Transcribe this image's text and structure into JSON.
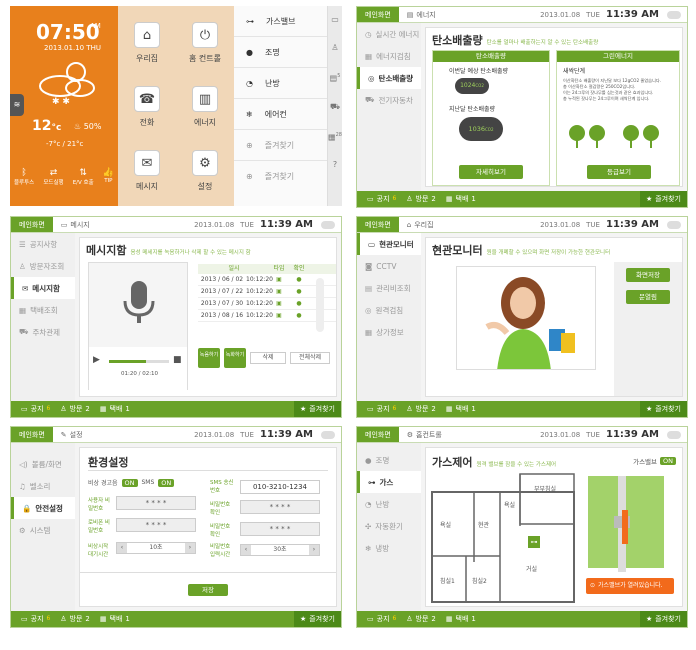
{
  "common": {
    "home": "메인화면",
    "date": "2013.01.08",
    "day": "TUE",
    "time": "11:39 AM",
    "bottom": {
      "notice": "공지",
      "notice_count": "6",
      "visit": "방문",
      "visit_count": "2",
      "delivery": "택배",
      "delivery_count": "1",
      "favorite": "즐겨찾기"
    }
  },
  "p1": {
    "time": "07:50",
    "ampm": "AM",
    "date": "2013.01.10 THU",
    "temp": "12",
    "temp_unit": "°c",
    "humidity": "50%",
    "range": "-7°c / 21°c",
    "status": [
      "블루투스",
      "모드실행",
      "E/V 호출",
      "TIP"
    ],
    "tiles": [
      "우리집",
      "홈 컨트롤",
      "전화",
      "에너지",
      "메시지",
      "설정"
    ],
    "list": [
      "가스밸브",
      "조명",
      "난방",
      "에어컨",
      "즐겨찾기",
      "즐겨찾기"
    ],
    "strip_badges": [
      "5",
      "28"
    ]
  },
  "p2": {
    "title": "에너지",
    "sidebar": [
      "실시간 에너지",
      "에너지검침",
      "탄소배출량",
      "전기자동차"
    ],
    "heading": "탄소배출량",
    "sub": "탄소를 얼마나 배출하는지 알 수 있는 탄소배출량",
    "box1": {
      "title": "탄소배출량",
      "line1": "이번달 예상 탄소배출량",
      "v1": "1024",
      "line2": "지난달 탄소배출량",
      "v2": "1036",
      "unit": "CO2",
      "btn": "자세히보기"
    },
    "box2": {
      "title": "그린에너지",
      "h": "새싹단계",
      "t1": "이산화탄소 배출량이 지난달 보다 12gCO2 줄었습니다.",
      "t2": "총 이산화탄소 절감량은 250CO2입니다.",
      "t3": "이는 24그루의 잣나무를 심는것과 같은 효과입니다.",
      "t4": "총 누적된 잣나무는 24그루이며 새싹단계 입니다.",
      "btn": "등급보기"
    }
  },
  "p3": {
    "title": "메시지",
    "sidebar": [
      "공지사항",
      "방문자조회",
      "메시지함",
      "택배조회",
      "주차관제"
    ],
    "heading": "메시지함",
    "sub": "음성 메세지를 녹음하거나 삭제 할 수 있는 메시지 함",
    "cols": [
      "일시",
      "타입",
      "확인"
    ],
    "rows": [
      {
        "d": "2013 / 06 / 02",
        "t": "10:12:20"
      },
      {
        "d": "2013 / 07 / 22",
        "t": "10:12:20"
      },
      {
        "d": "2013 / 07 / 30",
        "t": "10:12:20"
      },
      {
        "d": "2013 / 08 / 16",
        "t": "10:12:20"
      }
    ],
    "progress": "01:20 / 02:10",
    "progress_frac": 0.62,
    "btns": [
      "녹음하기",
      "녹화하기",
      "삭제",
      "전체삭제"
    ]
  },
  "p4": {
    "title": "우리집",
    "sidebar": [
      "현관모니터",
      "CCTV",
      "관리비조회",
      "원격검침",
      "상가정보"
    ],
    "heading": "현관모니터",
    "sub": "원을 개폐할 수 있으며 화면 저장이 가능한 현관모니터",
    "btns": [
      "화면저장",
      "문열림"
    ]
  },
  "p5": {
    "title": "설정",
    "sidebar": [
      "볼륨/화면",
      "벨소리",
      "안전설정",
      "시스템"
    ],
    "heading": "환경설정",
    "alarm": "비상 경고음",
    "sms": "SMS",
    "on": "ON",
    "sms_send": "SMS 송신번호",
    "phone": "010-3210-1234",
    "user_pw": "사용자 비밀번호",
    "pw_confirm": "비밀번호 확인",
    "lobby_pw": "로비폰 비밀번호",
    "pw_confirm2": "비밀번호 확인",
    "mask": "* * * *",
    "wait": "비상시작 대기시간",
    "wait_val": "10초",
    "input_time": "비밀번호 입력시간",
    "input_val": "30초",
    "save": "저장"
  },
  "p6": {
    "title": "홈컨트롤",
    "sidebar": [
      "조명",
      "가스",
      "난방",
      "자동환기",
      "냉방"
    ],
    "heading": "가스제어",
    "sub": "원격 밸브를 잠을 수 있는 가스제어",
    "valve": "가스밸브",
    "on": "ON",
    "rooms": [
      "부부침실",
      "욕실",
      "욕실",
      "현관",
      "거실",
      "침실1",
      "침실2"
    ],
    "msg": "가스밸브가 열려있습니다."
  }
}
